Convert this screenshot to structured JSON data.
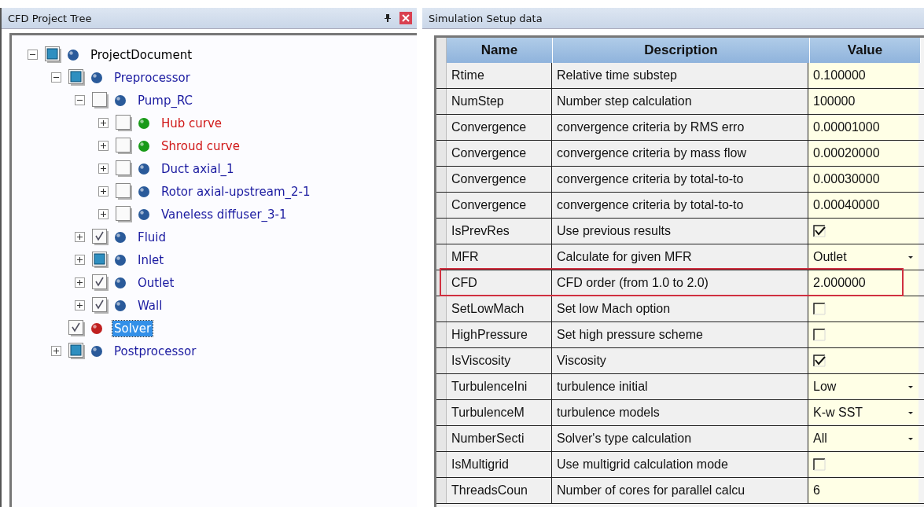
{
  "tree_panel": {
    "title": "CFD Project Tree"
  },
  "tree": [
    {
      "label": "ProjectDocument",
      "checked": false,
      "partial": true,
      "color": "#2a5a9a",
      "kind": "root",
      "expanded": true,
      "selected": false,
      "children": [
        {
          "label": "Preprocessor",
          "checked": false,
          "partial": true,
          "color": "#2a5a9a",
          "kind": "item",
          "expanded": true,
          "selected": false,
          "children": [
            {
              "label": "Pump_RC",
              "checked": false,
              "partial": false,
              "color": "#2a5a9a",
              "kind": "item",
              "expanded": true,
              "selected": false,
              "children": [
                {
                  "label": "Hub curve",
                  "checked": false,
                  "partial": false,
                  "color": "#189a18",
                  "kind": "curve",
                  "expanded": false,
                  "selected": false,
                  "has_children": true
                },
                {
                  "label": "Shroud curve",
                  "checked": false,
                  "partial": false,
                  "color": "#189a18",
                  "kind": "curve",
                  "expanded": false,
                  "selected": false,
                  "has_children": true
                },
                {
                  "label": "Duct axial_1",
                  "checked": false,
                  "partial": false,
                  "color": "#2a5a9a",
                  "kind": "item",
                  "expanded": false,
                  "selected": false,
                  "has_children": true
                },
                {
                  "label": "Rotor axial-upstream_2-1",
                  "checked": false,
                  "partial": false,
                  "color": "#2a5a9a",
                  "kind": "item",
                  "expanded": false,
                  "selected": false,
                  "has_children": true
                },
                {
                  "label": "Vaneless diffuser_3-1",
                  "checked": false,
                  "partial": false,
                  "color": "#2a5a9a",
                  "kind": "item",
                  "expanded": false,
                  "selected": false,
                  "has_children": true
                }
              ]
            },
            {
              "label": "Fluid",
              "checked": true,
              "partial": false,
              "color": "#2a5a9a",
              "kind": "item",
              "expanded": false,
              "selected": false,
              "has_children": true
            },
            {
              "label": "Inlet",
              "checked": false,
              "partial": true,
              "color": "#2a5a9a",
              "kind": "item",
              "expanded": false,
              "selected": false,
              "has_children": true
            },
            {
              "label": "Outlet",
              "checked": true,
              "partial": false,
              "color": "#2a5a9a",
              "kind": "item",
              "expanded": false,
              "selected": false,
              "has_children": true
            },
            {
              "label": "Wall",
              "checked": true,
              "partial": false,
              "color": "#2a5a9a",
              "kind": "item",
              "expanded": false,
              "selected": false,
              "has_children": true
            }
          ]
        },
        {
          "label": "Solver",
          "checked": true,
          "partial": false,
          "color": "#c02020",
          "selected": true,
          "has_children": false
        },
        {
          "label": "Postprocessor",
          "checked": false,
          "partial": true,
          "color": "#2a5a9a",
          "kind": "item",
          "expanded": false,
          "selected": false,
          "has_children": true
        }
      ]
    }
  ],
  "setup_panel": {
    "title": "Simulation Setup data"
  },
  "table": {
    "columns": [
      "Name",
      "Description",
      "Value"
    ],
    "rows": [
      {
        "name": "Rtime",
        "description": "Relative time substep",
        "kind": "text",
        "value": "0.100000",
        "highlighted": false
      },
      {
        "name": "NumStep",
        "description": "Number step calculation",
        "kind": "text",
        "value": "100000",
        "highlighted": false
      },
      {
        "name": "Convergence",
        "description": "convergence criteria by RMS erro",
        "kind": "text",
        "value": "0.00001000",
        "highlighted": false
      },
      {
        "name": "Convergence",
        "description": "convergence criteria by mass flow",
        "kind": "text",
        "value": "0.00020000",
        "highlighted": false
      },
      {
        "name": "Convergence",
        "description": "convergence criteria by total-to-to",
        "kind": "text",
        "value": "0.00030000",
        "highlighted": false
      },
      {
        "name": "Convergence",
        "description": "convergence criteria by total-to-to",
        "kind": "text",
        "value": "0.00040000",
        "highlighted": false
      },
      {
        "name": "IsPrevRes",
        "description": "Use previous results",
        "kind": "check",
        "checked": true,
        "highlighted": false
      },
      {
        "name": "MFR",
        "description": "Calculate for given MFR",
        "kind": "dropdown",
        "value": "Outlet",
        "highlighted": false
      },
      {
        "name": "CFD",
        "description": "CFD order (from 1.0 to 2.0)",
        "kind": "text",
        "value": "2.000000",
        "highlighted": true
      },
      {
        "name": "SetLowMach",
        "description": "Set low Mach option",
        "kind": "check",
        "checked": false,
        "highlighted": false
      },
      {
        "name": "HighPressure",
        "description": "Set high pressure scheme",
        "kind": "check",
        "checked": false,
        "highlighted": false
      },
      {
        "name": "IsViscosity",
        "description": "Viscosity",
        "kind": "check",
        "checked": true,
        "highlighted": false
      },
      {
        "name": "TurbulenceIni",
        "description": "turbulence initial",
        "kind": "dropdown",
        "value": "Low",
        "highlighted": false
      },
      {
        "name": "TurbulenceM",
        "description": "turbulence models",
        "kind": "dropdown",
        "value": "K-w SST",
        "highlighted": false
      },
      {
        "name": "NumberSecti",
        "description": "Solver's type calculation",
        "kind": "dropdown",
        "value": "All",
        "highlighted": false
      },
      {
        "name": "IsMultigrid",
        "description": "Use multigrid calculation mode",
        "kind": "check",
        "checked": false,
        "highlighted": false
      },
      {
        "name": "ThreadsCoun",
        "description": "Number of cores for parallel calcu",
        "kind": "text",
        "value": "6",
        "highlighted": false
      }
    ]
  }
}
